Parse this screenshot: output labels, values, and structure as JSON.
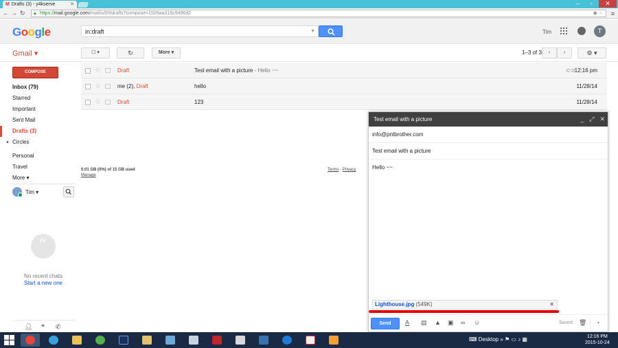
{
  "browser": {
    "tab_title": "Drafts (3) - y4kserve",
    "url_scheme": "https://",
    "url_host": "mail.google.com",
    "url_path": "/mail/u/0/#drafts?compose=1509aa316c9496d2"
  },
  "header": {
    "logo": [
      "G",
      "o",
      "o",
      "g",
      "l",
      "e"
    ],
    "search_value": "in:draft",
    "user_name": "Tim",
    "avatar_letter": "T"
  },
  "toolbar": {
    "gmail_label": "Gmail",
    "more_label": "More",
    "pager": "1–3 of 3"
  },
  "sidebar": {
    "compose_label": "COMPOSE",
    "items": [
      {
        "label": "Inbox (79)"
      },
      {
        "label": "Starred"
      },
      {
        "label": "Important"
      },
      {
        "label": "Sent Mail"
      },
      {
        "label": "Drafts (3)"
      },
      {
        "label": "Circles"
      },
      {
        "label": "Personal"
      },
      {
        "label": "Travel"
      },
      {
        "label": "More"
      }
    ],
    "hangouts_user": "Tim",
    "no_chats": "No recent chats",
    "start_new": "Start a new one"
  },
  "mail": {
    "rows": [
      {
        "sender_prefix": "",
        "sender_draft": "Draft",
        "subject": "Test email with a picture",
        "snippet": " - Hello ~~",
        "has_attachment": true,
        "date": "12:16 pm"
      },
      {
        "sender_prefix": "me (2), ",
        "sender_draft": "Draft",
        "subject": "hello",
        "snippet": "",
        "has_attachment": false,
        "date": "11/28/14"
      },
      {
        "sender_prefix": "",
        "sender_draft": "Draft",
        "subject": "123",
        "snippet": "",
        "has_attachment": false,
        "date": "11/28/14"
      }
    ],
    "storage": "0.01 GB (0%) of 15 GB used",
    "manage": "Manage",
    "terms": "Terms",
    "privacy": "Privacy"
  },
  "compose": {
    "title": "Test email with a picture",
    "to": "info@pntbrother.com",
    "subject": "Test email with a picture",
    "body": "Hello ~~",
    "attachment_name": "Lighthouse.jpg",
    "attachment_size": "(549K)",
    "send_label": "Send",
    "saved_label": "Saved"
  },
  "taskbar": {
    "desktop_label": "Desktop",
    "time": "12:16 PM",
    "date": "2015-10-24"
  },
  "colors": {
    "gmail_red": "#dd4b39",
    "blue_button": "#4d90fe",
    "compose_header": "#404040",
    "highlight_line": "#e40000",
    "taskbar": "#1a2a44"
  }
}
